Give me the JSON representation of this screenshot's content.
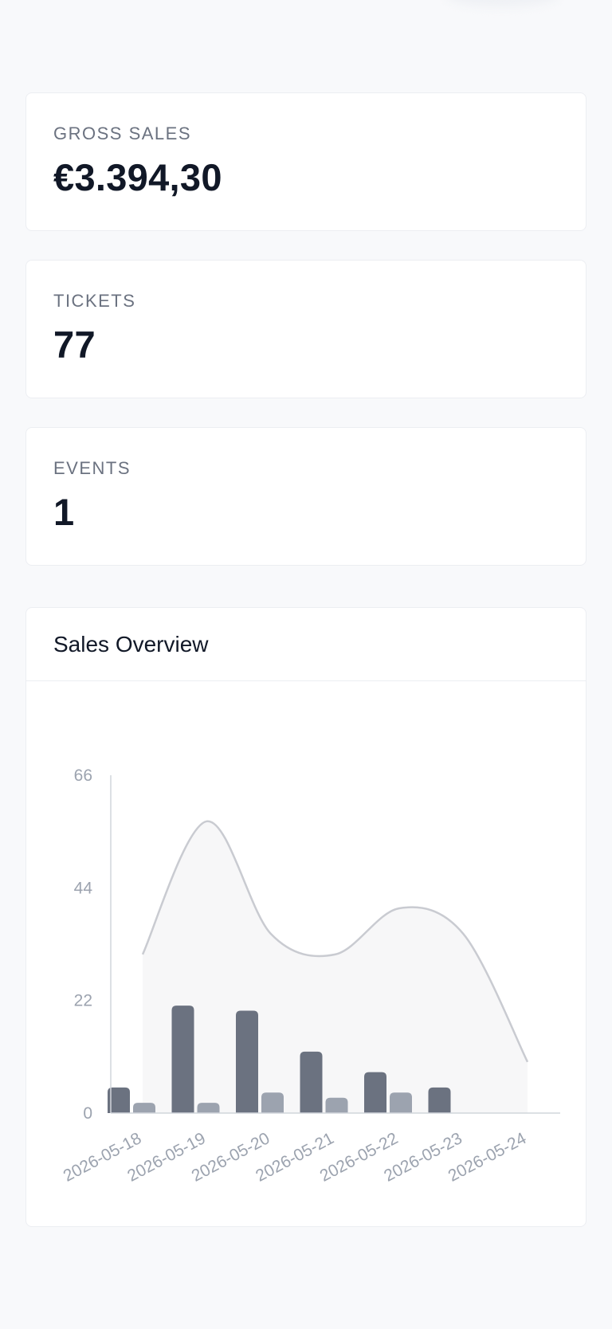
{
  "stats": {
    "gross_sales": {
      "label": "GROSS SALES",
      "value": "€3.394,30"
    },
    "tickets": {
      "label": "TICKETS",
      "value": "77"
    },
    "events": {
      "label": "EVENTS",
      "value": "1"
    }
  },
  "sales_overview": {
    "title": "Sales Overview"
  },
  "colors": {
    "bar_primary": "#6b7280",
    "bar_secondary": "#9ca3af",
    "area_fill": "#f7f7f8",
    "area_line": "#c9cbd1",
    "axis": "#d1d5db"
  },
  "chart_data": {
    "type": "bar",
    "categories": [
      "2026-05-18",
      "2026-05-19",
      "2026-05-20",
      "2026-05-21",
      "2026-05-22",
      "2026-05-23",
      "2026-05-24"
    ],
    "series": [
      {
        "type": "bar",
        "values": [
          5,
          21,
          20,
          12,
          8,
          5,
          0
        ]
      },
      {
        "type": "bar",
        "values": [
          2,
          2,
          4,
          3,
          4,
          0,
          0
        ]
      },
      {
        "type": "area",
        "values": [
          31,
          57,
          35,
          31,
          40,
          35,
          10
        ]
      }
    ],
    "yticks": [
      0,
      22,
      44,
      66
    ],
    "ylim": [
      0,
      66
    ],
    "title": "",
    "xlabel": "",
    "ylabel": "",
    "legend": "none",
    "grid": false
  }
}
